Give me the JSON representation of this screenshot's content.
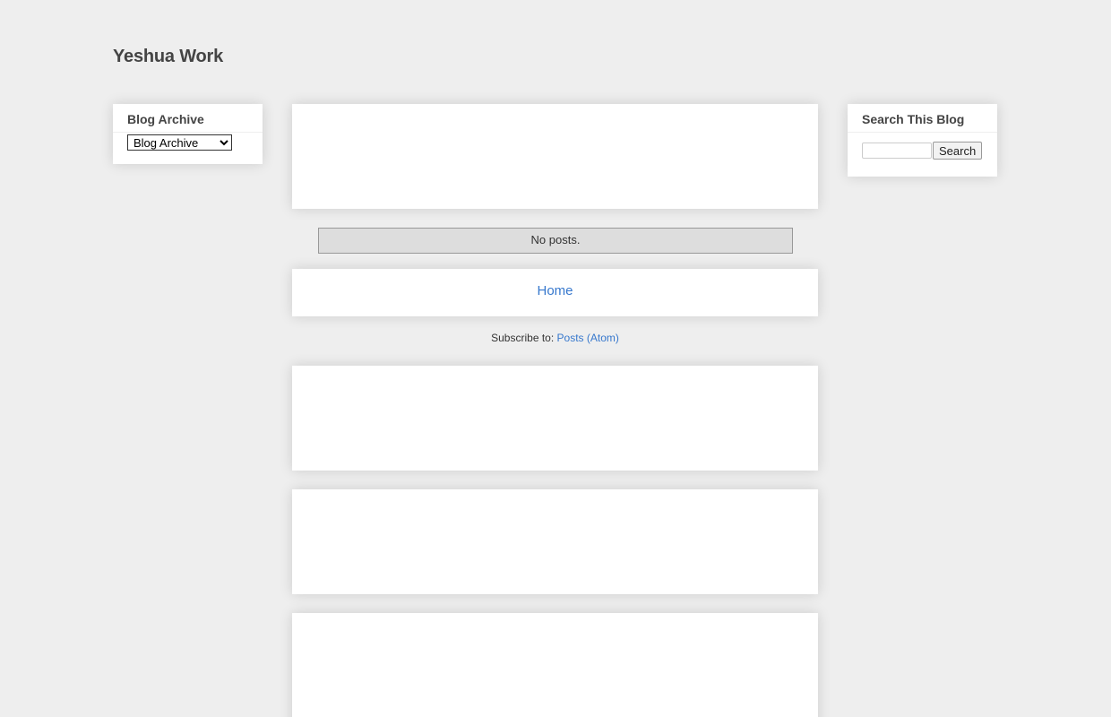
{
  "header": {
    "title": "Yeshua Work"
  },
  "sidebar_left": {
    "archive_widget": {
      "title": "Blog Archive",
      "select_value": "Blog Archive"
    }
  },
  "sidebar_right": {
    "search_widget": {
      "title": "Search This Blog",
      "input_value": "",
      "button_label": "Search"
    }
  },
  "main": {
    "no_posts_text": "No posts.",
    "home_link": "Home",
    "subscribe_prefix": "Subscribe to:",
    "subscribe_link": "Posts (Atom)"
  },
  "colors": {
    "background": "#eeeeee",
    "card": "#ffffff",
    "link": "#3778cd",
    "no_posts_bg": "#dddddd"
  }
}
